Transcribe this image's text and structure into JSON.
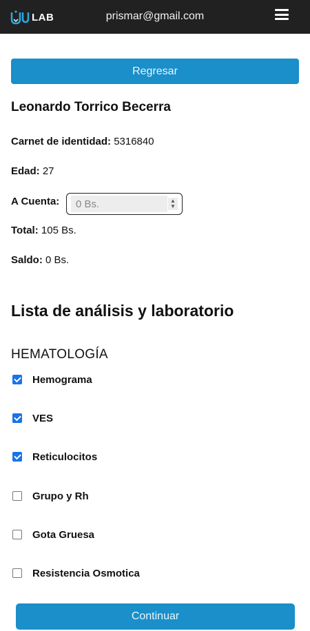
{
  "header": {
    "logo_text": "LAB",
    "email": "prismar@gmail.com",
    "menu_icon": "hamburger-menu-icon"
  },
  "actions": {
    "back_label": "Regresar",
    "continue_label": "Continuar"
  },
  "patient": {
    "name": "Leonardo Torrico Becerra",
    "ci_label": "Carnet de identidad:",
    "ci_value": "5316840",
    "age_label": "Edad:",
    "age_value": "27",
    "acuenta_label": "A Cuenta:",
    "acuenta_placeholder": "0 Bs.",
    "total_label": "Total:",
    "total_value": "105 Bs.",
    "saldo_label": "Saldo:",
    "saldo_value": "0 Bs."
  },
  "list": {
    "title": "Lista de análisis y laboratorio",
    "category": "HEMATOLOGÍA",
    "items": [
      {
        "label": "Hemograma",
        "checked": true
      },
      {
        "label": "VES",
        "checked": true
      },
      {
        "label": "Reticulocitos",
        "checked": true
      },
      {
        "label": "Grupo y Rh",
        "checked": false
      },
      {
        "label": "Gota Gruesa",
        "checked": false
      },
      {
        "label": "Resistencia Osmotica",
        "checked": false
      }
    ]
  },
  "colors": {
    "topbar": "#212121",
    "primary_button": "#1a8fc9",
    "checkbox_checked": "#1a73e8"
  }
}
